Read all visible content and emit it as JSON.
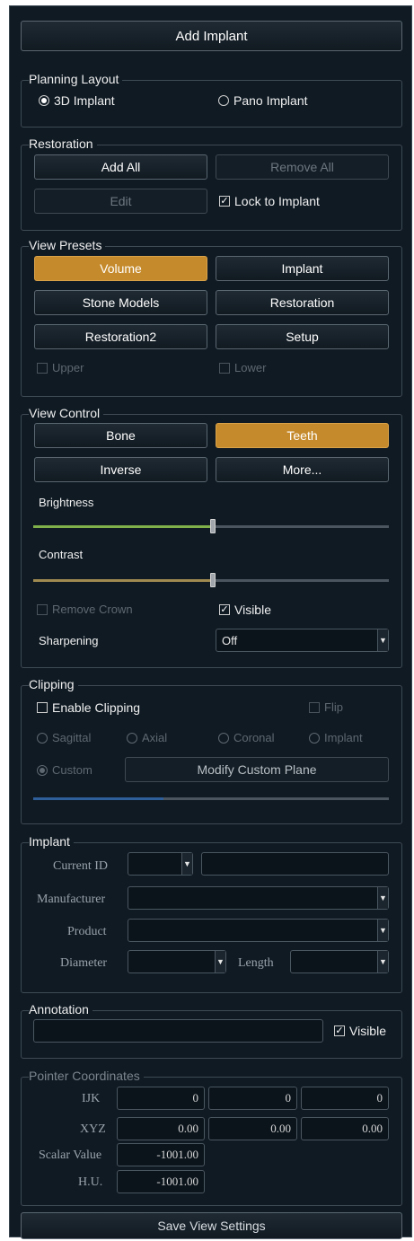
{
  "top_button": "Add Implant",
  "planning_layout": {
    "title": "Planning Layout",
    "option_3d": "3D Implant",
    "option_pano": "Pano Implant",
    "selected": "3D Implant"
  },
  "restoration": {
    "title": "Restoration",
    "add_all": "Add All",
    "remove_all": "Remove All",
    "edit": "Edit",
    "lock_label": "Lock to Implant",
    "lock_checked": true
  },
  "view_presets": {
    "title": "View Presets",
    "buttons": [
      "Volume",
      "Implant",
      "Stone Models",
      "Restoration",
      "Restoration2",
      "Setup"
    ],
    "active": "Volume",
    "upper": "Upper",
    "lower": "Lower"
  },
  "view_control": {
    "title": "View Control",
    "bone": "Bone",
    "teeth": "Teeth",
    "inverse": "Inverse",
    "more": "More...",
    "brightness_label": "Brightness",
    "brightness_value": 0.5,
    "contrast_label": "Contrast",
    "contrast_value": 0.5,
    "remove_crown": "Remove Crown",
    "visible": "Visible",
    "visible_checked": true,
    "sharpening_label": "Sharpening",
    "sharpening_value": "Off"
  },
  "clipping": {
    "title": "Clipping",
    "enable": "Enable Clipping",
    "flip": "Flip",
    "sagittal": "Sagittal",
    "axial": "Axial",
    "coronal": "Coronal",
    "implant": "Implant",
    "custom": "Custom",
    "modify": "Modify Custom Plane",
    "slider_value": 0.36
  },
  "implant": {
    "title": "Implant",
    "current_id": "Current ID",
    "manufacturer": "Manufacturer",
    "product": "Product",
    "diameter": "Diameter",
    "length": "Length"
  },
  "annotation": {
    "title": "Annotation",
    "visible": "Visible",
    "visible_checked": true
  },
  "pointer": {
    "title": "Pointer Coordinates",
    "ijk_label": "IJK",
    "ijk": [
      "0",
      "0",
      "0"
    ],
    "xyz_label": "XYZ",
    "xyz": [
      "0.00",
      "0.00",
      "0.00"
    ],
    "scalar_label": "Scalar Value",
    "scalar": "-1001.00",
    "hu_label": "H.U.",
    "hu": "-1001.00"
  },
  "bottom_button": "Save View Settings",
  "colors": {
    "accent": "#c58a2b",
    "panel_bg": "#0f1a23",
    "brightness_track": "#7fb04a",
    "contrast_track": "#a08a50",
    "clip_track": "#2f5f9a"
  }
}
